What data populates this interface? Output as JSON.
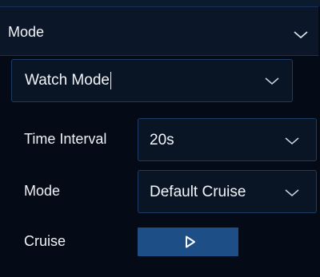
{
  "header": {
    "title": "Mode",
    "chevron_icon": "chevron-down-icon"
  },
  "mode_select": {
    "value": "Watch Mode",
    "chevron_icon": "chevron-down-icon"
  },
  "fields": {
    "time_interval": {
      "label": "Time Interval",
      "value": "20s"
    },
    "mode": {
      "label": "Mode",
      "value": "Default Cruise"
    },
    "cruise": {
      "label": "Cruise",
      "button_icon": "play-icon"
    }
  },
  "colors": {
    "background": "#050b16",
    "header_background": "#0b1729",
    "field_border": "#1e3c63",
    "button_accent": "#1d4f86",
    "text": "#f2f5f9"
  }
}
